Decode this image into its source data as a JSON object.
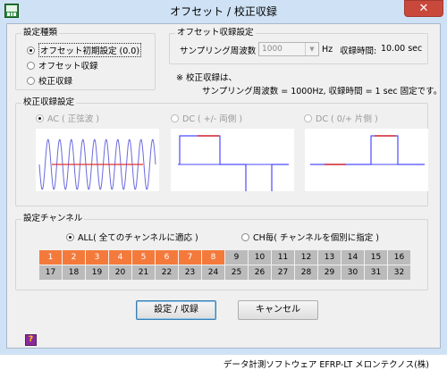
{
  "window": {
    "title": "オフセット / 校正収録",
    "close_symbol": "✕"
  },
  "settings_type": {
    "legend": "設定種類",
    "options": [
      {
        "label": "オフセット初期設定 (0.0)",
        "selected": true
      },
      {
        "label": "オフセット収録",
        "selected": false
      },
      {
        "label": "校正収録",
        "selected": false
      }
    ]
  },
  "offset_settings": {
    "legend": "オフセット収録設定",
    "sampling_label": "サンプリング周波数",
    "sampling_value": "1000",
    "unit": "Hz",
    "record_time_label": "収録時間:",
    "record_time_value": "10.00 sec",
    "note_line1": "※ 校正収録は、",
    "note_line2": "サンプリング周波数 = 1000Hz, 収録時間 = 1 sec  固定です。"
  },
  "calibration": {
    "legend": "校正収録設定",
    "options": [
      {
        "label": "AC ( 正弦波 )",
        "selected": true,
        "enabled": false
      },
      {
        "label": "DC ( +/- 両側 )",
        "selected": false,
        "enabled": false
      },
      {
        "label": "DC ( 0/+ 片側 )",
        "selected": false,
        "enabled": false
      }
    ],
    "colors": {
      "wave": "#6a6ae0",
      "level": "#e03030",
      "axis": "#4a4aff"
    }
  },
  "channels": {
    "legend": "設定チャンネル",
    "mode_all": "ALL( 全てのチャンネルに適応 )",
    "mode_each": "CH毎( チャンネルを個別に指定 )",
    "mode_all_selected": true,
    "row1": [
      "1",
      "2",
      "3",
      "4",
      "5",
      "6",
      "7",
      "8",
      "9",
      "10",
      "11",
      "12",
      "13",
      "14",
      "15",
      "16"
    ],
    "row2": [
      "17",
      "18",
      "19",
      "20",
      "21",
      "22",
      "23",
      "24",
      "25",
      "26",
      "27",
      "28",
      "29",
      "30",
      "31",
      "32"
    ],
    "selected_channels": [
      "1",
      "2",
      "3",
      "4",
      "5",
      "6",
      "7",
      "8"
    ],
    "colors": {
      "selected": "#f47a3c",
      "unselected": "#bbbbbb"
    }
  },
  "buttons": {
    "apply": "設定 / 収録",
    "cancel": "キャンセル"
  },
  "help_icon_glyph": "?",
  "footer": "データ計測ソフトウェア EFRP-LT メロンテクノス(株)"
}
